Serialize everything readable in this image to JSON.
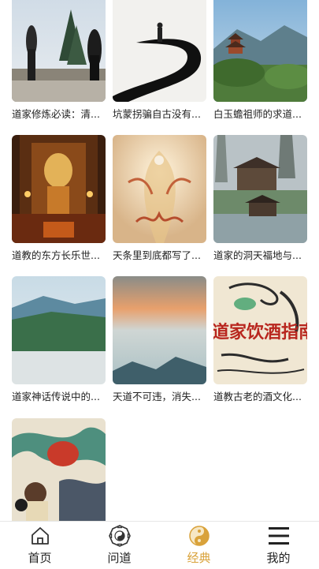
{
  "articles": [
    {
      "title": "道家修炼必读：清..."
    },
    {
      "title": "坑蒙拐骗自古没有..."
    },
    {
      "title": "白玉蟾祖师的求道..."
    },
    {
      "title": "道教的东方长乐世..."
    },
    {
      "title": "天条里到底都写了..."
    },
    {
      "title": "道家的洞天福地与..."
    },
    {
      "title": "道家神话传说中的..."
    },
    {
      "title": "天道不可违，消失..."
    },
    {
      "title": "道教古老的酒文化..."
    },
    {
      "title": ""
    }
  ],
  "thumbnail_text": {
    "wine_guide": "道家饮酒指南"
  },
  "tabbar": {
    "tabs": [
      {
        "label": "首页",
        "icon": "home-icon"
      },
      {
        "label": "问道",
        "icon": "bagua-icon"
      },
      {
        "label": "经典",
        "icon": "yin-yang-icon"
      },
      {
        "label": "我的",
        "icon": "menu-icon"
      }
    ],
    "active_index": 2,
    "active_color": "#d9a23a"
  }
}
